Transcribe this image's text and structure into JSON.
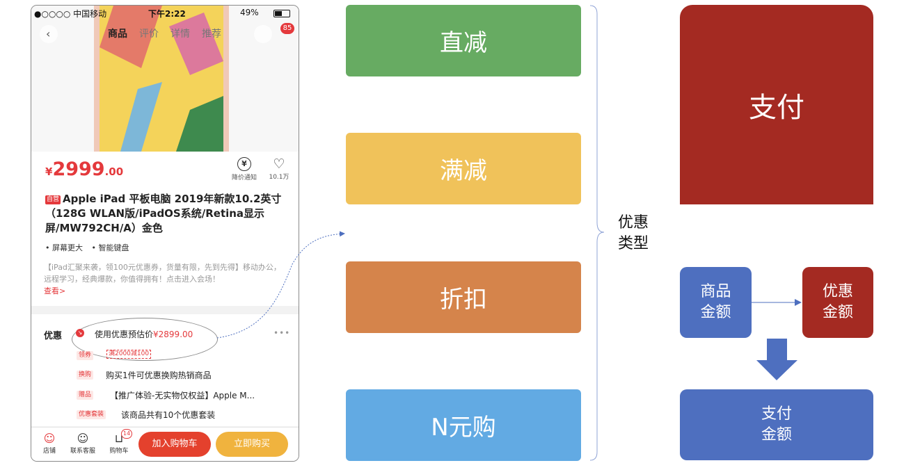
{
  "phone": {
    "status": {
      "carrier": "●○○○○ 中国移动",
      "time": "下午2:22",
      "battery": "49%"
    },
    "nav_tabs": [
      "商品",
      "评价",
      "详情",
      "推荐"
    ],
    "cart_count_badge": "85",
    "price": {
      "symbol": "¥",
      "integer": "2999",
      "decimal": ".00"
    },
    "price_alert_label": "降价通知",
    "favorite_count": "10.1万",
    "self_operated_tag": "自营",
    "product_title": "Apple iPad 平板电脑 2019年新款10.2英寸（128G WLAN版/iPadOS系统/Retina显示屏/MW792CH/A）金色",
    "bullets": [
      "• 屏幕更大",
      "• 智能键盘"
    ],
    "promo_text": "【iPad汇聚来袭，领100元优惠券，货量有限，先到先得】移动办公，远程学习，经典爆款，你值得拥有！点击进入会场！",
    "promo_link": "查看>",
    "discount_section": {
      "label": "优惠",
      "estimate_text": "使用优惠预估价",
      "estimate_price": "¥2899.00",
      "rows": [
        {
          "tag": "领券",
          "text": "满2000减100"
        },
        {
          "tag": "换购",
          "text": "购买1件可优惠换购热销商品"
        },
        {
          "tag": "赠品",
          "text": "【推广体验-无实物仅权益】Apple M..."
        },
        {
          "tag": "优惠套装",
          "text": "该商品共有10个优惠套装"
        }
      ]
    },
    "bottom_bar": {
      "store": "店铺",
      "service": "联系客服",
      "cart": "购物车",
      "cart_badge": "14",
      "add_to_cart": "加入购物车",
      "buy_now": "立即购买"
    }
  },
  "discount_types": {
    "label": "优惠类型",
    "items": [
      {
        "label": "直减",
        "color": "#67ab62"
      },
      {
        "label": "满减",
        "color": "#f0c25a"
      },
      {
        "label": "折扣",
        "color": "#d5844b"
      },
      {
        "label": "N元购",
        "color": "#62aae3"
      }
    ]
  },
  "right_panel": {
    "pay": "支付",
    "goods_amount": [
      "商品",
      "金额"
    ],
    "discount_amount": [
      "优惠",
      "金额"
    ],
    "pay_amount": [
      "支付",
      "金额"
    ],
    "colors": {
      "red": "#a42a22",
      "blue": "#4e6fbf",
      "arrow": "#4e6fbf"
    }
  }
}
